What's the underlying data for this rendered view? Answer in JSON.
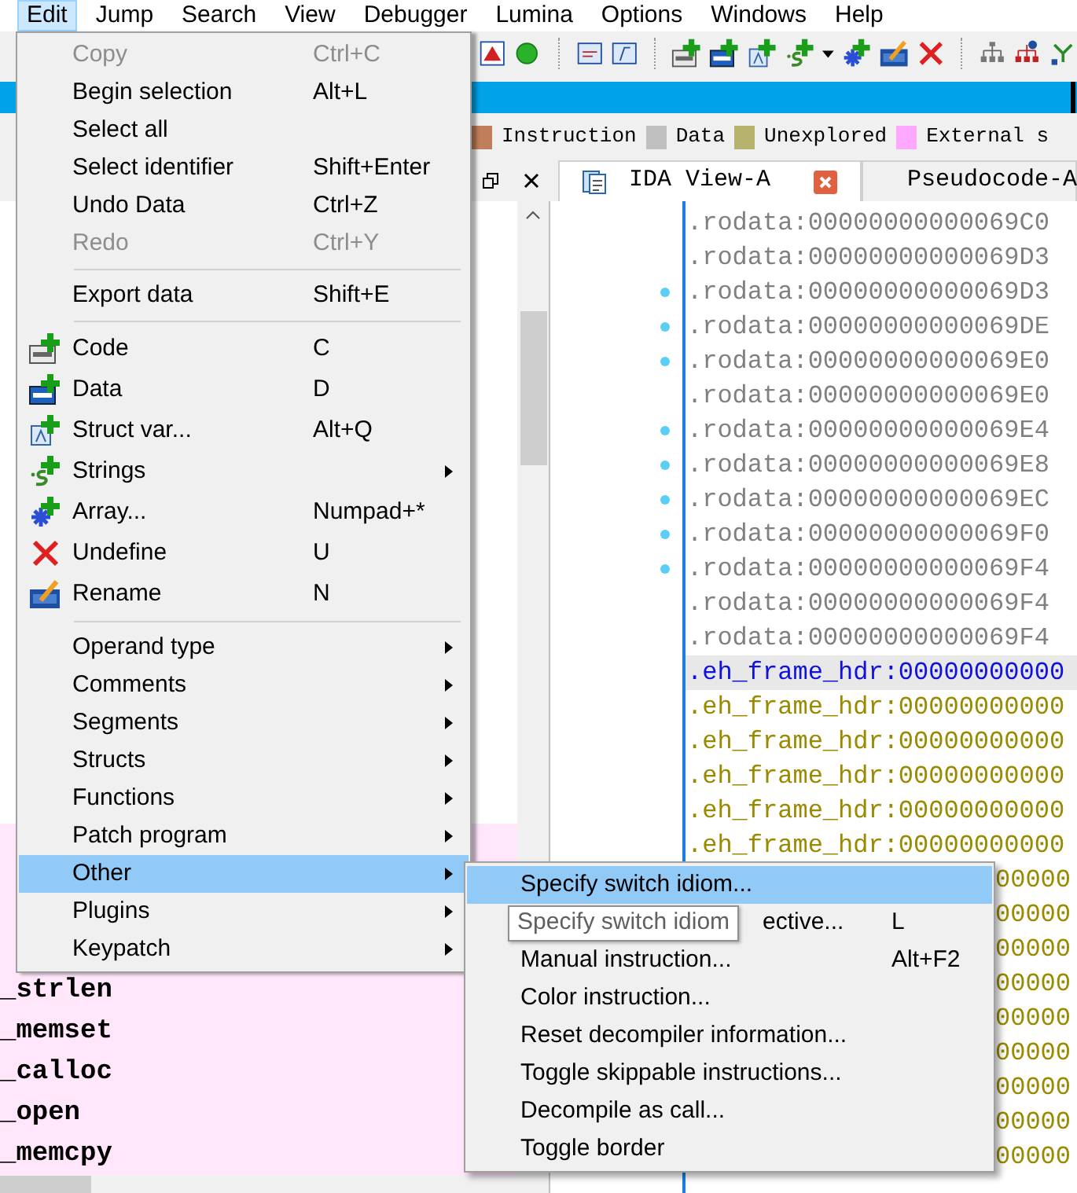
{
  "menubar": [
    {
      "label": "Edit",
      "selected": true
    },
    {
      "label": "Jump",
      "selected": false
    },
    {
      "label": "Search",
      "selected": false
    },
    {
      "label": "View",
      "selected": false
    },
    {
      "label": "Debugger",
      "selected": false
    },
    {
      "label": "Lumina",
      "selected": false
    },
    {
      "label": "Options",
      "selected": false
    },
    {
      "label": "Windows",
      "selected": false
    },
    {
      "label": "Help",
      "selected": false
    }
  ],
  "legend": [
    {
      "label": "Instruction",
      "color": "#c07e5a"
    },
    {
      "label": "Data",
      "color": "#c0c0c0"
    },
    {
      "label": "Unexplored",
      "color": "#b5b36e"
    },
    {
      "label": "External s",
      "color": "#ffa8ff"
    }
  ],
  "tabs": [
    {
      "label": "IDA View-A",
      "selected": true
    },
    {
      "label": "Pseudocode-A",
      "selected": false
    }
  ],
  "functions": [
    {
      "name": "_strlen"
    },
    {
      "name": "_memset"
    },
    {
      "name": "_calloc"
    },
    {
      "name": "_open"
    },
    {
      "name": "_memcpy"
    }
  ],
  "listing": [
    {
      "kind": "rodata",
      "text": ".rodata:00000000000069C0",
      "marked": false,
      "selected": false
    },
    {
      "kind": "rodata",
      "text": ".rodata:00000000000069D3",
      "marked": false,
      "selected": false
    },
    {
      "kind": "rodata",
      "text": ".rodata:00000000000069D3",
      "marked": true,
      "selected": false
    },
    {
      "kind": "rodata",
      "text": ".rodata:00000000000069DE",
      "marked": true,
      "selected": false
    },
    {
      "kind": "rodata",
      "text": ".rodata:00000000000069E0",
      "marked": true,
      "selected": false
    },
    {
      "kind": "rodata",
      "text": ".rodata:00000000000069E0",
      "marked": false,
      "selected": false
    },
    {
      "kind": "rodata",
      "text": ".rodata:00000000000069E4",
      "marked": true,
      "selected": false
    },
    {
      "kind": "rodata",
      "text": ".rodata:00000000000069E8",
      "marked": true,
      "selected": false
    },
    {
      "kind": "rodata",
      "text": ".rodata:00000000000069EC",
      "marked": true,
      "selected": false
    },
    {
      "kind": "rodata",
      "text": ".rodata:00000000000069F0",
      "marked": true,
      "selected": false
    },
    {
      "kind": "rodata",
      "text": ".rodata:00000000000069F4",
      "marked": true,
      "selected": false
    },
    {
      "kind": "rodata",
      "text": ".rodata:00000000000069F4",
      "marked": false,
      "selected": false
    },
    {
      "kind": "rodata",
      "text": ".rodata:00000000000069F4",
      "marked": false,
      "selected": false
    },
    {
      "kind": "eh",
      "text": ".eh_frame_hdr:00000000000",
      "marked": false,
      "selected": true
    },
    {
      "kind": "eh",
      "text": ".eh_frame_hdr:00000000000",
      "marked": false,
      "selected": false
    },
    {
      "kind": "eh",
      "text": ".eh_frame_hdr:00000000000",
      "marked": false,
      "selected": false
    },
    {
      "kind": "eh",
      "text": ".eh_frame_hdr:00000000000",
      "marked": false,
      "selected": false
    },
    {
      "kind": "eh",
      "text": ".eh_frame_hdr:00000000000",
      "marked": false,
      "selected": false
    },
    {
      "kind": "eh",
      "text": ".eh_frame_hdr:00000000000",
      "marked": false,
      "selected": false
    },
    {
      "kind": "partial",
      "text": "00000",
      "marked": false,
      "selected": false
    },
    {
      "kind": "partial",
      "text": "00000",
      "marked": false,
      "selected": false
    },
    {
      "kind": "partial",
      "text": "00000",
      "marked": false,
      "selected": false
    },
    {
      "kind": "partial",
      "text": "00000",
      "marked": false,
      "selected": false
    },
    {
      "kind": "partial",
      "text": "00000",
      "marked": false,
      "selected": false
    },
    {
      "kind": "partial",
      "text": "00000",
      "marked": false,
      "selected": false
    },
    {
      "kind": "partial",
      "text": "00000",
      "marked": false,
      "selected": false
    },
    {
      "kind": "partial",
      "text": "00000",
      "marked": false,
      "selected": false
    },
    {
      "kind": "partial",
      "text": "00000",
      "marked": false,
      "selected": false
    }
  ],
  "edit_menu": [
    {
      "kind": "item",
      "label": "Copy",
      "shortcut": "Ctrl+C",
      "disabled": true,
      "selected": false,
      "submenu": false
    },
    {
      "kind": "item",
      "label": "Begin selection",
      "shortcut": "Alt+L",
      "disabled": false,
      "selected": false,
      "submenu": false
    },
    {
      "kind": "item",
      "label": "Select all",
      "disabled": false,
      "selected": false,
      "submenu": false
    },
    {
      "kind": "item",
      "label": "Select identifier",
      "shortcut": "Shift+Enter",
      "disabled": false,
      "selected": false,
      "submenu": false
    },
    {
      "kind": "item",
      "label": "Undo Data",
      "shortcut": "Ctrl+Z",
      "disabled": false,
      "selected": false,
      "submenu": false
    },
    {
      "kind": "item",
      "label": "Redo",
      "shortcut": "Ctrl+Y",
      "disabled": true,
      "selected": false,
      "submenu": false
    },
    {
      "kind": "separator"
    },
    {
      "kind": "item",
      "label": "Export data",
      "shortcut": "Shift+E",
      "disabled": false,
      "selected": false,
      "submenu": false
    },
    {
      "kind": "separator"
    },
    {
      "kind": "icon-item",
      "label": "Code",
      "shortcut": "C",
      "disabled": false,
      "selected": false,
      "submenu": false
    },
    {
      "kind": "icon-item",
      "label": "Data",
      "shortcut": "D",
      "disabled": false,
      "selected": false,
      "submenu": false
    },
    {
      "kind": "icon-item",
      "label": "Struct var...",
      "shortcut": "Alt+Q",
      "disabled": false,
      "selected": false,
      "submenu": false
    },
    {
      "kind": "icon-item",
      "label": "Strings",
      "disabled": false,
      "selected": false,
      "submenu": true
    },
    {
      "kind": "icon-item",
      "label": "Array...",
      "shortcut": "Numpad+*",
      "disabled": false,
      "selected": false,
      "submenu": false
    },
    {
      "kind": "icon-item",
      "label": "Undefine",
      "shortcut": "U",
      "disabled": false,
      "selected": false,
      "submenu": false
    },
    {
      "kind": "icon-item",
      "label": "Rename",
      "shortcut": "N",
      "disabled": false,
      "selected": false,
      "submenu": false
    },
    {
      "kind": "separator"
    },
    {
      "kind": "item",
      "label": "Operand type",
      "disabled": false,
      "selected": false,
      "submenu": true
    },
    {
      "kind": "item",
      "label": "Comments",
      "disabled": false,
      "selected": false,
      "submenu": true
    },
    {
      "kind": "item",
      "label": "Segments",
      "disabled": false,
      "selected": false,
      "submenu": true
    },
    {
      "kind": "item",
      "label": "Structs",
      "disabled": false,
      "selected": false,
      "submenu": true
    },
    {
      "kind": "item",
      "label": "Functions",
      "disabled": false,
      "selected": false,
      "submenu": true
    },
    {
      "kind": "item",
      "label": "Patch program",
      "disabled": false,
      "selected": false,
      "submenu": true
    },
    {
      "kind": "item",
      "label": "Other",
      "disabled": false,
      "selected": true,
      "submenu": true
    },
    {
      "kind": "item",
      "label": "Plugins",
      "disabled": false,
      "selected": false,
      "submenu": true
    },
    {
      "kind": "item",
      "label": "Keypatch",
      "disabled": false,
      "selected": false,
      "submenu": true
    }
  ],
  "other_menu": [
    {
      "kind": "item",
      "label": "Specify switch idiom...",
      "selected": true
    },
    {
      "kind": "partial",
      "label": "ective...",
      "shortcut": "L",
      "selected": false
    },
    {
      "kind": "item",
      "label": "Manual instruction...",
      "shortcut": "Alt+F2",
      "selected": false
    },
    {
      "kind": "item",
      "label": "Color instruction...",
      "selected": false
    },
    {
      "kind": "item",
      "label": "Reset decompiler information...",
      "selected": false
    },
    {
      "kind": "item",
      "label": "Toggle skippable instructions...",
      "selected": false
    },
    {
      "kind": "item",
      "label": "Decompile as call...",
      "selected": false
    },
    {
      "kind": "item",
      "label": "Toggle border",
      "selected": false
    }
  ],
  "tooltip": {
    "text": "Specify switch idiom"
  }
}
